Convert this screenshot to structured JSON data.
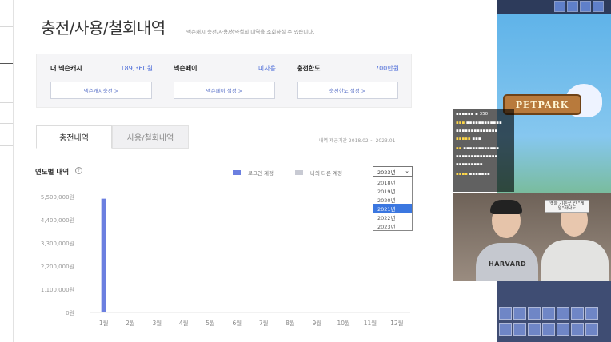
{
  "page": {
    "title": "충전/사용/철회내역",
    "description": "넥슨캐시 충전/사용/청약철회 내역을 조회하실 수 있습니다."
  },
  "summary": [
    {
      "label": "내 넥슨캐시",
      "value": "189,360원",
      "button": "넥슨캐시충전 >"
    },
    {
      "label": "넥슨페이",
      "value": "미사용",
      "button": "넥슨페이 설정 >"
    },
    {
      "label": "충전한도",
      "value": "700만원",
      "button": "충전한도 설정 >"
    }
  ],
  "tabs": [
    {
      "label": "충전내역",
      "active": true
    },
    {
      "label": "사용/철회내역",
      "active": false
    }
  ],
  "period_text": "내역 제공기간 2018.02 ~ 2023.01",
  "chart_section": {
    "title": "연도별 내역",
    "help_icon": "question-icon",
    "legend": [
      {
        "label": "로그인 계정",
        "color": "#6b7fe0"
      },
      {
        "label": "나의 다른 계정",
        "color": "#c8cad3"
      }
    ],
    "year_select": {
      "value": "2023년",
      "options": [
        "2018년",
        "2019년",
        "2020년",
        "2021년",
        "2022년",
        "2023년"
      ],
      "highlighted": "2021년"
    }
  },
  "chart_data": {
    "type": "bar",
    "categories": [
      "1월",
      "2월",
      "3월",
      "4월",
      "5월",
      "6월",
      "7월",
      "8월",
      "9월",
      "10월",
      "11월",
      "12월"
    ],
    "series": [
      {
        "name": "로그인 계정",
        "values": [
          5400000,
          0,
          0,
          0,
          0,
          0,
          0,
          0,
          0,
          0,
          0,
          0
        ],
        "color": "#6b7fe0"
      }
    ],
    "yticks": [
      0,
      1100000,
      2200000,
      3300000,
      4400000,
      5500000
    ],
    "ytick_labels": [
      "0원",
      "1,100,000원",
      "2,200,000원",
      "3,300,000원",
      "4,400,000원",
      "5,500,000원"
    ],
    "ylim": [
      0,
      5500000
    ],
    "grid": false
  },
  "stream": {
    "sign_text": "PETPARK",
    "cam_shirt_text": "HARVARD",
    "cam_label": "옛을 기른곳 인 \"게임\"하다도"
  },
  "colors": {
    "accent": "#4a6ad8",
    "bar": "#6b7fe0",
    "select_highlight": "#3b77e0"
  }
}
